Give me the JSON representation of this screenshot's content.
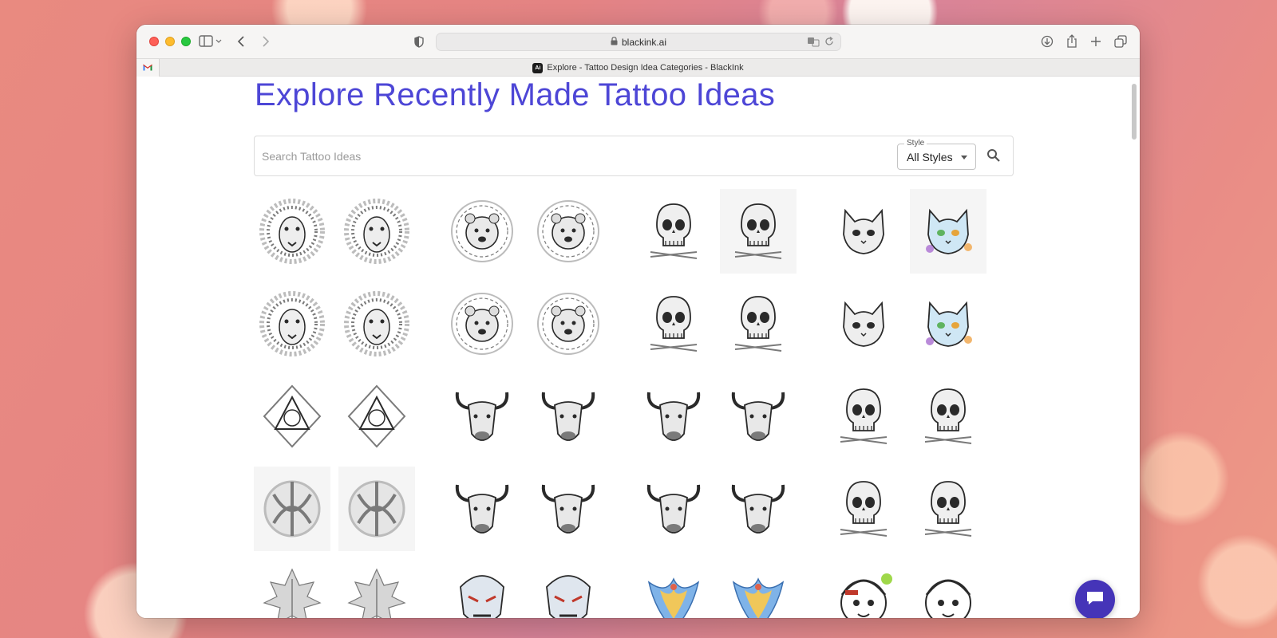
{
  "browser": {
    "url": "blackink.ai",
    "tab_title": "Explore - Tattoo Design Idea Categories - BlackInk",
    "pinned_tab_icon": "gmail-icon"
  },
  "page": {
    "title": "Explore Recently Made Tattoo Ideas",
    "search": {
      "placeholder": "Search Tattoo Ideas",
      "value": ""
    },
    "style_filter": {
      "legend": "Style",
      "value": "All Styles"
    },
    "colors": {
      "title": "#4d46d6",
      "chat_button": "#4534b8"
    }
  },
  "gallery": {
    "rows": [
      [
        "lion",
        "lion",
        "bear-mandala",
        "bear-mandala",
        "skull-octopus",
        "skull",
        "cat",
        "cat-colorful"
      ],
      [
        "lion",
        "lion",
        "wolf-mandala",
        "bear-sunburst",
        "skull-tentacles",
        "skull-tentacles",
        "mushroom-cat",
        "cat-floral"
      ],
      [
        "geometric-triangle",
        "geometric-emblem",
        "bull",
        "bull",
        "bull",
        "bull",
        "skull-crossbones",
        "skeleton-crossbones"
      ],
      [
        "celtic-knot",
        "celtic-knot",
        "bull",
        "bull",
        "bull-profile",
        "bull",
        "skull-drums",
        "skull-crossbones"
      ],
      [
        "leaf",
        "leaf",
        "oni-mask",
        "oni-mask",
        "phoenix",
        "phoenix",
        "cartoon",
        "anime"
      ]
    ]
  }
}
